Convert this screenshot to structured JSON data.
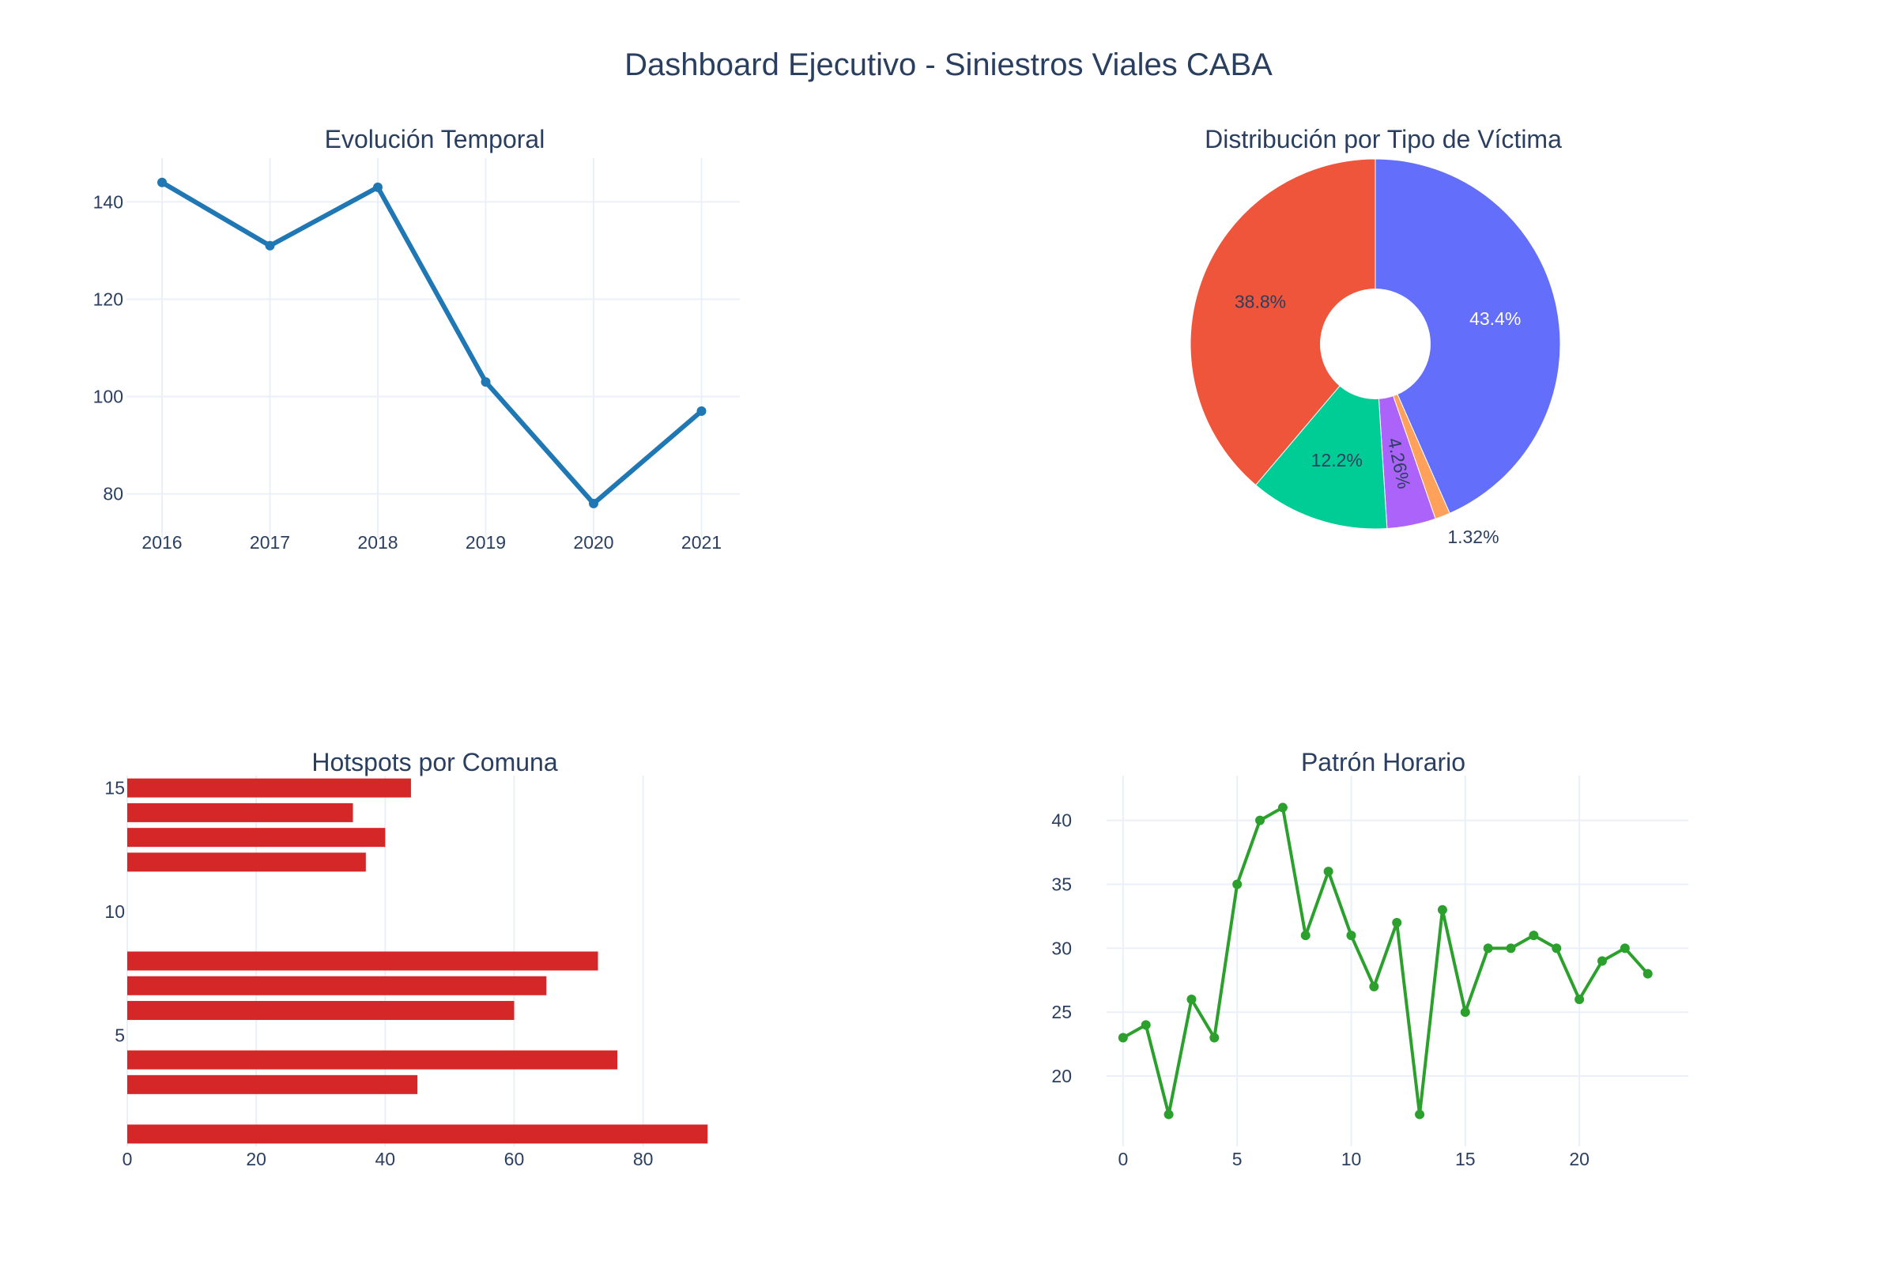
{
  "title": "Dashboard Ejecutivo - Siniestros Viales CABA",
  "chart_data": [
    {
      "type": "line",
      "title": "Evolución Temporal",
      "x": [
        2016,
        2017,
        2018,
        2019,
        2020,
        2021
      ],
      "values": [
        144,
        131,
        143,
        103,
        78,
        97
      ],
      "ylim": [
        71,
        149
      ],
      "yticks": [
        80,
        100,
        120,
        140
      ],
      "xticks": [
        "2016",
        "2017",
        "2018",
        "2019",
        "2020",
        "2021"
      ],
      "grid": true,
      "color": "#1f77b4"
    },
    {
      "type": "pie",
      "title": "Distribución por Tipo de Víctima",
      "hole": true,
      "slices": [
        {
          "value": 43.4,
          "label": "43.4%",
          "color": "#636efa"
        },
        {
          "value": 1.32,
          "label": "1.32%",
          "color": "#ffa15a"
        },
        {
          "value": 4.26,
          "label": "4.26%",
          "color": "#ab63fa"
        },
        {
          "value": 12.2,
          "label": "12.2%",
          "color": "#00cc96"
        },
        {
          "value": 38.8,
          "label": "38.8%",
          "color": "#ef553b"
        }
      ]
    },
    {
      "type": "bar",
      "orientation": "horizontal",
      "title": "Hotspots por Comuna",
      "categories": [
        1,
        3,
        4,
        6,
        7,
        8,
        12,
        13,
        14,
        15
      ],
      "values": [
        90,
        45,
        76,
        60,
        65,
        73,
        37,
        40,
        35,
        44
      ],
      "xlim": [
        0,
        95
      ],
      "xticks": [
        0,
        20,
        40,
        60,
        80
      ],
      "ylim": [
        0.5,
        15.5
      ],
      "yticks": [
        5,
        10,
        15
      ],
      "grid": true,
      "color": "#d62728"
    },
    {
      "type": "line",
      "title": "Patrón Horario",
      "x": [
        0,
        1,
        2,
        3,
        4,
        5,
        6,
        7,
        8,
        9,
        10,
        11,
        12,
        13,
        14,
        15,
        16,
        17,
        18,
        19,
        20,
        21,
        22,
        23
      ],
      "values": [
        23,
        24,
        17,
        26,
        23,
        35,
        40,
        41,
        31,
        36,
        31,
        27,
        32,
        17,
        33,
        25,
        30,
        30,
        31,
        30,
        26,
        29,
        30,
        28
      ],
      "xlim": [
        -1,
        24.5
      ],
      "ylim": [
        14.5,
        43.5
      ],
      "xticks": [
        0,
        5,
        10,
        15,
        20
      ],
      "yticks": [
        20,
        25,
        30,
        35,
        40
      ],
      "grid": true,
      "color": "#2ca02c"
    }
  ]
}
